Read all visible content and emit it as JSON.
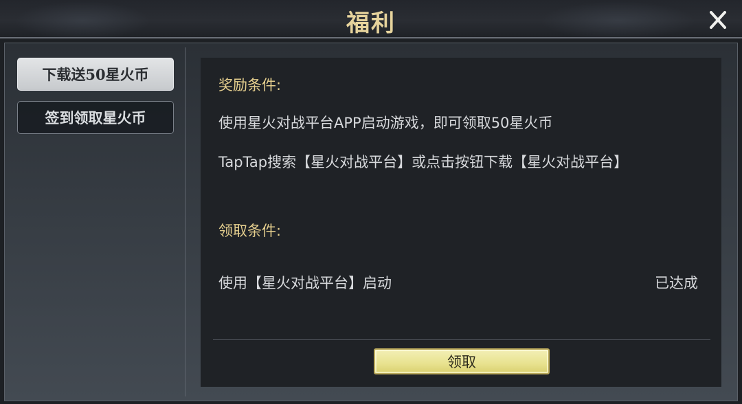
{
  "header": {
    "title": "福利",
    "close_icon": "close-icon"
  },
  "sidebar": {
    "tabs": [
      {
        "label": "下载送50星火币",
        "active": true
      },
      {
        "label": "签到领取星火币",
        "active": false
      }
    ]
  },
  "content": {
    "reward_heading": "奖励条件:",
    "reward_line1": "使用星火对战平台APP启动游戏，即可领取50星火币",
    "reward_line2": "TapTap搜索【星火对战平台】或点击按钮下载【星火对战平台】",
    "claim_heading": "领取条件:",
    "claim_condition": "使用【星火对战平台】启动",
    "claim_status": "已达成",
    "claim_button": "领取"
  },
  "colors": {
    "title_gold": "#e6d39c",
    "heading_gold": "#e5cf8e",
    "button_yellow": "#ece68f",
    "panel_dark": "#1f2226"
  }
}
